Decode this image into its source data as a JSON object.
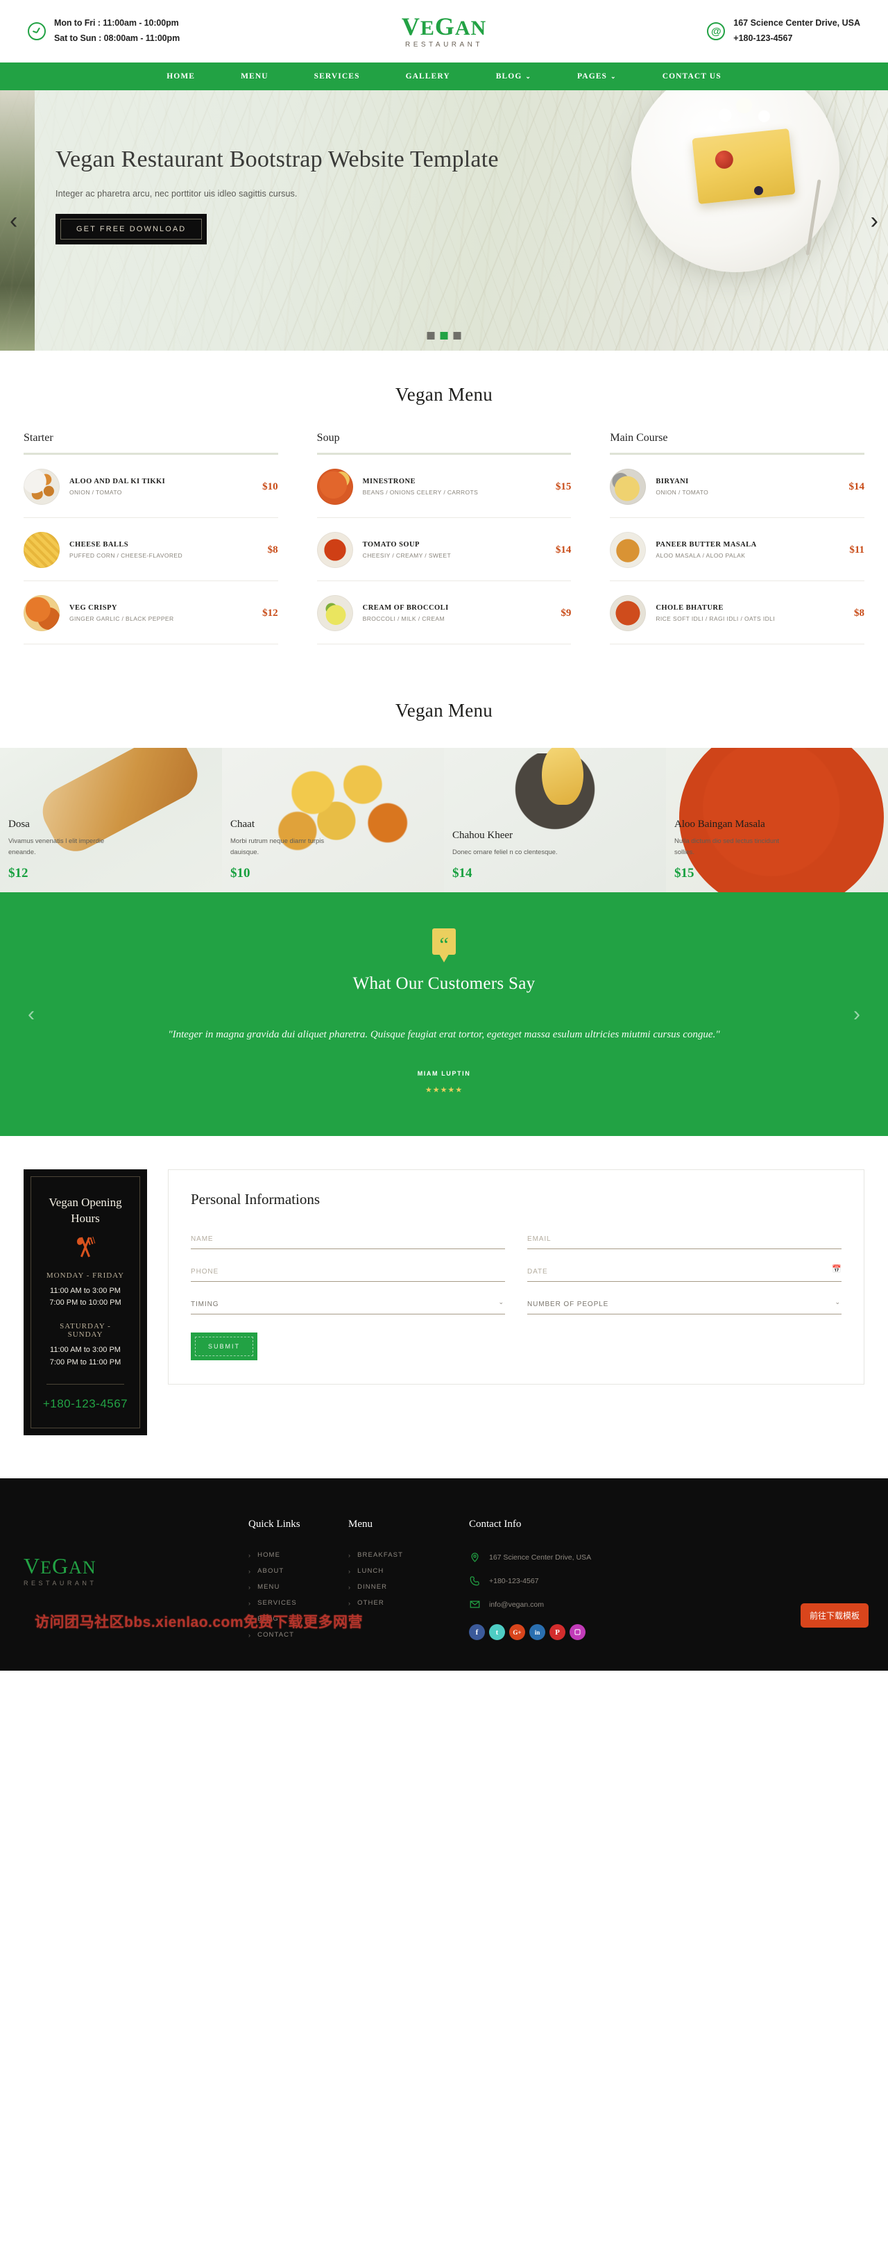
{
  "topbar": {
    "hours_line1": "Mon to Fri : 11:00am - 10:00pm",
    "hours_line2": "Sat to Sun : 08:00am - 11:00pm",
    "clock_icon": "clock-icon",
    "at_icon": "at-icon",
    "address": "167 Science Center Drive, USA",
    "phone": "+180-123-4567",
    "logo_cap": "V",
    "logo_rest": "EGAN",
    "logo_g": "G",
    "logo_text": "VEGAN",
    "logo_sub": "RESTAURANT"
  },
  "nav": {
    "items": [
      {
        "label": "HOME",
        "caret": false
      },
      {
        "label": "MENU",
        "caret": false
      },
      {
        "label": "SERVICES",
        "caret": false
      },
      {
        "label": "GALLERY",
        "caret": false
      },
      {
        "label": "BLOG",
        "caret": true
      },
      {
        "label": "PAGES",
        "caret": true
      },
      {
        "label": "CONTACT US",
        "caret": false
      }
    ],
    "caret_glyph": "⌄"
  },
  "hero": {
    "title": "Vegan Restaurant Bootstrap Website Template",
    "subtitle": "Integer ac pharetra arcu, nec porttitor uis idleo sagittis cursus.",
    "button": "GET FREE DOWNLOAD",
    "prev_glyph": "‹",
    "next_glyph": "›",
    "active_dot": 2,
    "dot_count": 3
  },
  "menu_section": {
    "title": "Vegan Menu",
    "columns": [
      {
        "title": "Starter",
        "items": [
          {
            "name": "ALOO AND DAL KI TIKKI",
            "desc": "ONION / TOMATO",
            "price": "$10",
            "thumb": "t-tikki"
          },
          {
            "name": "CHEESE BALLS",
            "desc": "PUFFED CORN / CHEESE-FLAVORED",
            "price": "$8",
            "thumb": "t-cheese"
          },
          {
            "name": "VEG CRISPY",
            "desc": "GINGER GARLIC / BLACK PEPPER",
            "price": "$12",
            "thumb": "t-veg"
          }
        ]
      },
      {
        "title": "Soup",
        "items": [
          {
            "name": "MINESTRONE",
            "desc": "BEANS / ONIONS CELERY / CARROTS",
            "price": "$15",
            "thumb": "t-mine"
          },
          {
            "name": "TOMATO SOUP",
            "desc": "CHEESIY / CREAMY / SWEET",
            "price": "$14",
            "thumb": "t-tomato"
          },
          {
            "name": "CREAM OF BROCCOLI",
            "desc": "BROCCOLI / MILK / CREAM",
            "price": "$9",
            "thumb": "t-brocc"
          }
        ]
      },
      {
        "title": "Main Course",
        "items": [
          {
            "name": "BIRYANI",
            "desc": "ONION / TOMATO",
            "price": "$14",
            "thumb": "t-biryani"
          },
          {
            "name": "PANEER BUTTER MASALA",
            "desc": "ALOO MASALA / ALOO PALAK",
            "price": "$11",
            "thumb": "t-paneer"
          },
          {
            "name": "CHOLE BHATURE",
            "desc": "RICE SOFT IDLI / RAGI IDLI / OATS IDLI",
            "price": "$8",
            "thumb": "t-chole"
          }
        ]
      }
    ]
  },
  "gallery_section": {
    "title": "Vegan Menu",
    "cards": [
      {
        "name": "Dosa",
        "desc": "Vivamus venenatis l elit imperdie eneande.",
        "price": "$12",
        "img": "g-dosa"
      },
      {
        "name": "Chaat",
        "desc": "Morbi rutrum neque diamr turpis dauisque.",
        "price": "$10",
        "img": "g-chaat"
      },
      {
        "name": "Chahou Kheer",
        "desc": "Donec ornare feliel n co clentesque.",
        "price": "$14",
        "img": "g-kheer"
      },
      {
        "name": "Aloo Baingan Masala",
        "desc": "Nulla dictum dio sed lectus tincidunt sollies.",
        "price": "$15",
        "img": "g-aloo"
      }
    ]
  },
  "testimonial": {
    "quote_icon": "quote-icon",
    "title": "What Our Customers Say",
    "quote": "\"Integer in magna gravida dui aliquet pharetra. Quisque feugiat erat tortor, egeteget massa esulum ultricies miutmi cursus congue.\"",
    "author": "MIAM LUPTIN",
    "stars": "★★★★★",
    "prev_glyph": "‹",
    "next_glyph": "›"
  },
  "hours_card": {
    "title": "Vegan Opening Hours",
    "utensils_icon": "utensils-icon",
    "blocks": [
      {
        "day": "MONDAY - FRIDAY",
        "t1": "11:00 AM to 3:00 PM",
        "t2": "7:00 PM to 10:00 PM"
      },
      {
        "day": "SATURDAY - SUNDAY",
        "t1": "11:00 AM to 3:00 PM",
        "t2": "7:00 PM to 11:00 PM"
      }
    ],
    "phone": "+180-123-4567"
  },
  "form": {
    "title": "Personal Informations",
    "name_placeholder": "NAME",
    "email_placeholder": "EMAIL",
    "phone_placeholder": "PHONE",
    "date_placeholder": "DATE",
    "timing_value": "TIMING",
    "people_value": "NUMBER OF PEOPLE",
    "calendar_icon": "calendar-icon",
    "chevron_glyph": "⌄",
    "submit": "SUBMIT"
  },
  "footer": {
    "logo_text": "VEGAN",
    "logo_sub": "RESTAURANT",
    "quick": {
      "title": "Quick Links",
      "items": [
        "HOME",
        "ABOUT",
        "MENU",
        "SERVICES",
        "BLOG",
        "CONTACT"
      ]
    },
    "menu": {
      "title": "Menu",
      "items": [
        "BREAKFAST",
        "LUNCH",
        "DINNER",
        "OTHER"
      ]
    },
    "contact": {
      "title": "Contact Info",
      "address": "167 Science Center Drive, USA",
      "phone": "+180-123-4567",
      "email": "info@vegan.com",
      "location_icon": "location-pin-icon",
      "phone_icon": "phone-icon",
      "mail_icon": "mail-icon"
    },
    "socials": [
      {
        "name": "facebook-icon",
        "glyph": "f",
        "color": "#3b5a9a"
      },
      {
        "name": "twitter-icon",
        "glyph": "t",
        "color": "#4ecdc4"
      },
      {
        "name": "google-plus-icon",
        "glyph": "G+",
        "color": "#d9451c"
      },
      {
        "name": "linkedin-icon",
        "glyph": "in",
        "color": "#2a6fb0"
      },
      {
        "name": "pinterest-icon",
        "glyph": "P",
        "color": "#d32d2d"
      },
      {
        "name": "instagram-icon",
        "glyph": "▢",
        "color": "#c13bb8"
      }
    ],
    "arrow_glyph": "›"
  },
  "overlay": {
    "watermark": "访问团马社区bbs.xienlao.com免费下载更多网营",
    "float_button": "前往下载模板"
  },
  "colors": {
    "brand_green": "#22a244",
    "price_orange": "#c84b17",
    "gallery_green": "#17a03f",
    "dark": "#0d0d0d",
    "yellow": "#ebcf5e"
  }
}
